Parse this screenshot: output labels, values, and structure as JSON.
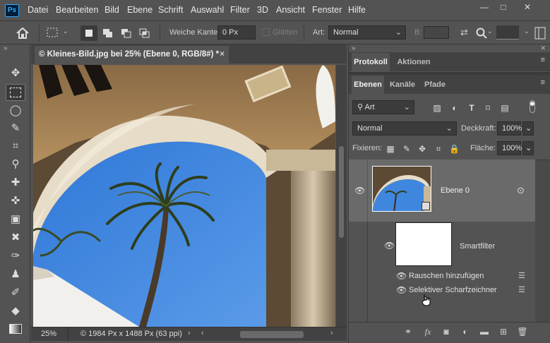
{
  "menubar": {
    "app_logo": "Ps",
    "items": [
      "Datei",
      "Bearbeiten",
      "Bild",
      "Ebene",
      "Schrift",
      "Auswahl",
      "Filter",
      "3D",
      "Ansicht",
      "Fenster",
      "Hilfe"
    ],
    "window_controls": {
      "minimize": "—",
      "restore": "□",
      "close": "✕"
    }
  },
  "options": {
    "feather_label": "Weiche Kante:",
    "feather_value": "0 Px",
    "antialias_label": "Glätten",
    "style_label": "Art:",
    "style_value": "Normal",
    "width_label": "B:"
  },
  "document": {
    "tab_title": "© Kleines-Bild.jpg bei 25% (Ebene 0, RGB/8#) *",
    "close": "×",
    "zoom": "25%",
    "info": "© 1984 Px x 1488 Px (63 ppi)"
  },
  "panels": {
    "top_tabs": [
      "Protokoll",
      "Aktionen"
    ],
    "layer_tabs": [
      "Ebenen",
      "Kanäle",
      "Pfade"
    ],
    "filter_kind": "Art",
    "blend_mode": "Normal",
    "opacity_label": "Deckkraft:",
    "opacity_value": "100%",
    "lock_label": "Fixieren:",
    "fill_label": "Fläche:",
    "fill_value": "100%"
  },
  "layers": {
    "layer0_name": "Ebene 0",
    "smartfilter_label": "Smartfilter",
    "filters": [
      "Rauschen hinzufügen",
      "Selektiver Scharfzeichner"
    ]
  },
  "colors": {
    "sky": "#3f86de",
    "accent": "#31a8ff",
    "panel": "#535353",
    "dark": "#424242"
  }
}
